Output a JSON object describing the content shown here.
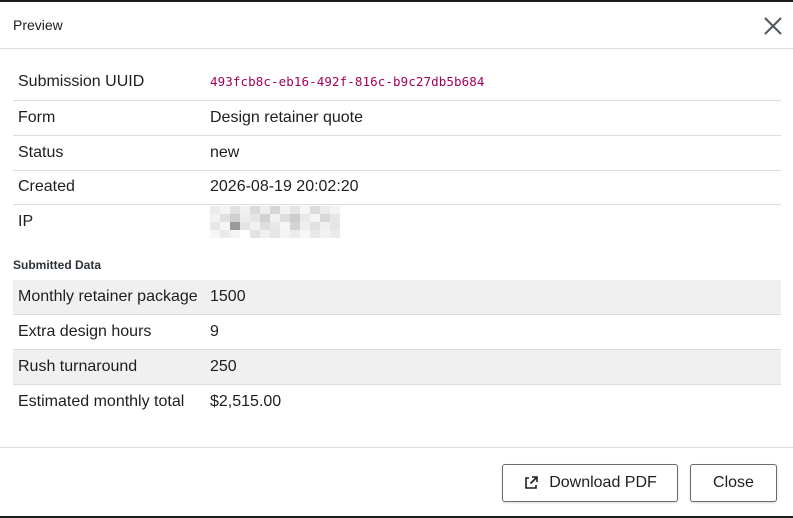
{
  "modal": {
    "title": "Preview",
    "close_icon": "close-icon"
  },
  "details": {
    "rows": [
      {
        "label": "Submission UUID",
        "value": "493fcb8c-eb16-492f-816c-b9c27db5b684"
      },
      {
        "label": "Form",
        "value": "Design retainer quote"
      },
      {
        "label": "Status",
        "value": "new"
      },
      {
        "label": "Created",
        "value": "2026-08-19 20:02:20"
      },
      {
        "label": "IP",
        "value": ""
      }
    ]
  },
  "submitted_data": {
    "heading": "Submitted Data",
    "rows": [
      {
        "label": "Monthly retainer package",
        "value": "1500"
      },
      {
        "label": "Extra design hours",
        "value": "9"
      },
      {
        "label": "Rush turnaround",
        "value": "250"
      },
      {
        "label": "Estimated monthly total",
        "value": "$2,515.00"
      }
    ]
  },
  "footer": {
    "download_label": "Download PDF",
    "download_icon": "external-link-icon",
    "close_label": "Close"
  },
  "colors": {
    "uuid_text": "#a3005b",
    "striped_row": "#f0f0f0",
    "border": "#dcdcde"
  }
}
